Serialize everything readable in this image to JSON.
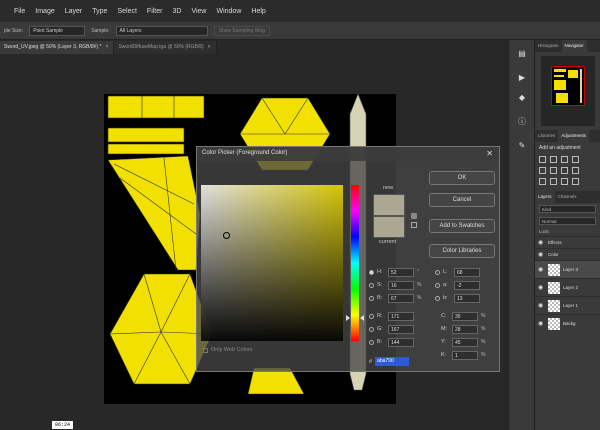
{
  "menu": [
    "File",
    "Image",
    "Layer",
    "Type",
    "Select",
    "Filter",
    "3D",
    "View",
    "Window",
    "Help"
  ],
  "options_bar": {
    "sample_size_label": "ple Size:",
    "sample_size_value": "Point Sample",
    "sample_label": "Sample:",
    "sample_value": "All Layers",
    "ring_button": "Show Sampling Ring"
  },
  "tabs": [
    {
      "label": "Sword_UV.jpeg @ 50% (Layer 3, RGB/8#) *",
      "active": true
    },
    {
      "label": "SwordDiffuseMap.tga @ 50% (RGB/8)",
      "active": false
    }
  ],
  "dialog": {
    "title": "Color Picker (Foreground Color)",
    "close": "✕",
    "new_label": "new",
    "current_label": "current",
    "buttons": {
      "ok": "OK",
      "cancel": "Cancel",
      "add_swatches": "Add to Swatches",
      "libraries": "Color Libraries"
    },
    "fields": {
      "H": "52",
      "S": "16",
      "B": "67",
      "R": "171",
      "G": "167",
      "Bb": "144",
      "L": "68",
      "a": "-2",
      "b": "13",
      "C": "35",
      "M": "28",
      "Y": "45",
      "K": "1"
    },
    "units": {
      "deg": "°",
      "pct": "%"
    },
    "hex_label": "#",
    "hex_value": "aba790",
    "only_web": "Only Web Colors"
  },
  "panels": {
    "top_tabs": [
      "Histogram",
      "Navigator"
    ],
    "mid_tabs": [
      "Libraries",
      "Adjustments"
    ],
    "adj_title": "Add an adjustment",
    "layers_tabs": [
      "Layers",
      "Channels"
    ],
    "kind": "Kind",
    "normal": "Normal",
    "lock": "Lock:",
    "layers": [
      {
        "name": "Effects"
      },
      {
        "name": "Color"
      },
      {
        "name": "Layer 3"
      },
      {
        "name": "Layer 2"
      },
      {
        "name": "Layer 1"
      },
      {
        "name": "Backg"
      }
    ]
  },
  "status": {
    "timecode": "06:24"
  },
  "colors": {
    "uv_yellow": "#f2e000",
    "picked": "#aba790",
    "hex_highlight": "#2d5bd1"
  }
}
